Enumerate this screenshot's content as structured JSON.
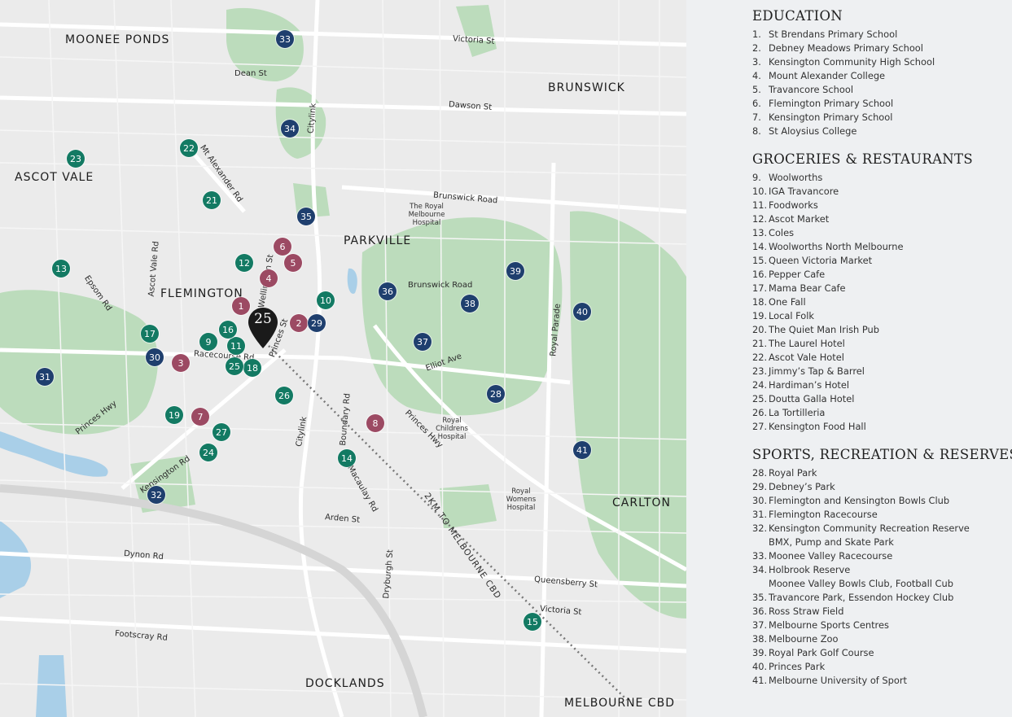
{
  "map": {
    "area_labels": [
      "MOONEE PONDS",
      "BRUNSWICK",
      "ASCOT VALE",
      "PARKVILLE",
      "FLEMINGTON",
      "CARLTON",
      "DOCKLANDS",
      "MELBOURNE CBD"
    ],
    "place_labels": [
      "The Royal Melbourne Hospital",
      "Royal Childrens Hospital",
      "Royal Womens Hospital"
    ],
    "streets": [
      "Victoria St",
      "Dean St",
      "Dawson St",
      "Citylink",
      "Mt Alexander Rd",
      "Brunswick Road",
      "Racecourse Rd",
      "Epsom Rd",
      "Ascot Vale Rd",
      "Wellington St",
      "Princes St",
      "Brunswick Road",
      "Elliot Ave",
      "Royal Parade",
      "Princes Hwy",
      "Princes Hwy",
      "Citylink",
      "Boundary Rd",
      "Macaulay Rd",
      "Kensington Rd",
      "Arden St",
      "Dynon Rd",
      "Dryburgh St",
      "Queensberry St",
      "Victoria St",
      "Footscray Rd"
    ],
    "route_label": "2KM TO MELBOURNE CBD",
    "property_marker": "25",
    "colors": {
      "education": "#9c4a63",
      "groceries": "#137a63",
      "sports": "#1f3f6e",
      "pin": "#1a1a1a",
      "park": "#b8dab8",
      "water": "#9ec7e6"
    },
    "markers": [
      {
        "n": "1",
        "cat": "education"
      },
      {
        "n": "2",
        "cat": "education"
      },
      {
        "n": "3",
        "cat": "education"
      },
      {
        "n": "4",
        "cat": "education"
      },
      {
        "n": "5",
        "cat": "education"
      },
      {
        "n": "6",
        "cat": "education"
      },
      {
        "n": "7",
        "cat": "education"
      },
      {
        "n": "8",
        "cat": "education"
      },
      {
        "n": "9",
        "cat": "groceries"
      },
      {
        "n": "10",
        "cat": "groceries"
      },
      {
        "n": "11",
        "cat": "groceries"
      },
      {
        "n": "12",
        "cat": "groceries"
      },
      {
        "n": "13",
        "cat": "groceries"
      },
      {
        "n": "14",
        "cat": "groceries"
      },
      {
        "n": "15",
        "cat": "groceries"
      },
      {
        "n": "16",
        "cat": "groceries"
      },
      {
        "n": "17",
        "cat": "groceries"
      },
      {
        "n": "18",
        "cat": "groceries"
      },
      {
        "n": "19",
        "cat": "groceries"
      },
      {
        "n": "21",
        "cat": "groceries"
      },
      {
        "n": "22",
        "cat": "groceries"
      },
      {
        "n": "23",
        "cat": "groceries"
      },
      {
        "n": "24",
        "cat": "groceries"
      },
      {
        "n": "25",
        "cat": "groceries"
      },
      {
        "n": "26",
        "cat": "groceries"
      },
      {
        "n": "27",
        "cat": "groceries"
      },
      {
        "n": "28",
        "cat": "sports"
      },
      {
        "n": "29",
        "cat": "sports"
      },
      {
        "n": "30",
        "cat": "sports"
      },
      {
        "n": "31",
        "cat": "sports"
      },
      {
        "n": "32",
        "cat": "sports"
      },
      {
        "n": "33",
        "cat": "sports"
      },
      {
        "n": "34",
        "cat": "sports"
      },
      {
        "n": "35",
        "cat": "sports"
      },
      {
        "n": "36",
        "cat": "sports"
      },
      {
        "n": "37",
        "cat": "sports"
      },
      {
        "n": "38",
        "cat": "sports"
      },
      {
        "n": "39",
        "cat": "sports"
      },
      {
        "n": "40",
        "cat": "sports"
      },
      {
        "n": "41",
        "cat": "sports"
      }
    ]
  },
  "legend": {
    "education": {
      "title": "EDUCATION",
      "items": [
        {
          "n": "1.",
          "name": "St Brendans Primary School"
        },
        {
          "n": "2.",
          "name": "Debney Meadows Primary School"
        },
        {
          "n": "3.",
          "name": "Kensington Community High School"
        },
        {
          "n": "4.",
          "name": "Mount Alexander College"
        },
        {
          "n": "5.",
          "name": "Travancore School"
        },
        {
          "n": "6.",
          "name": "Flemington Primary School"
        },
        {
          "n": "7.",
          "name": "Kensington Primary School"
        },
        {
          "n": "8.",
          "name": "St Aloysius College"
        }
      ]
    },
    "groceries": {
      "title": "GROCERIES & RESTAURANTS",
      "items": [
        {
          "n": "9.",
          "name": "Woolworths"
        },
        {
          "n": "10.",
          "name": "IGA Travancore"
        },
        {
          "n": "11.",
          "name": "Foodworks"
        },
        {
          "n": "12.",
          "name": "Ascot Market"
        },
        {
          "n": "13.",
          "name": "Coles"
        },
        {
          "n": "14.",
          "name": "Woolworths North Melbourne"
        },
        {
          "n": "15.",
          "name": "Queen Victoria Market"
        },
        {
          "n": "16.",
          "name": "Pepper Cafe"
        },
        {
          "n": "17.",
          "name": "Mama Bear Cafe"
        },
        {
          "n": "18.",
          "name": "One Fall"
        },
        {
          "n": "19.",
          "name": "Local Folk"
        },
        {
          "n": "20.",
          "name": "The Quiet Man Irish Pub"
        },
        {
          "n": "21.",
          "name": "The Laurel Hotel"
        },
        {
          "n": "22.",
          "name": "Ascot Vale Hotel"
        },
        {
          "n": "23.",
          "name": "Jimmy’s Tap & Barrel"
        },
        {
          "n": "24.",
          "name": "Hardiman’s Hotel"
        },
        {
          "n": "25.",
          "name": "Doutta Galla Hotel"
        },
        {
          "n": "26.",
          "name": "La Tortilleria"
        },
        {
          "n": "27.",
          "name": "Kensington Food Hall"
        }
      ]
    },
    "sports": {
      "title": "SPORTS, RECREATION & RESERVES",
      "items": [
        {
          "n": "28.",
          "name": "Royal Park"
        },
        {
          "n": "29.",
          "name": "Debney’s Park"
        },
        {
          "n": "30.",
          "name": "Flemington and Kensington Bowls Club"
        },
        {
          "n": "31.",
          "name": "Flemington Racecourse"
        },
        {
          "n": "32.",
          "name": "Kensington Community Recreation Reserve"
        },
        {
          "n": "",
          "name": "BMX, Pump and Skate Park"
        },
        {
          "n": "33.",
          "name": "Moonee Valley Racecourse"
        },
        {
          "n": "34.",
          "name": "Holbrook Reserve"
        },
        {
          "n": "",
          "name": "Moonee Valley Bowls Club, Football Cub"
        },
        {
          "n": "35.",
          "name": "Travancore Park, Essendon Hockey Club"
        },
        {
          "n": "36.",
          "name": "Ross Straw Field"
        },
        {
          "n": "37.",
          "name": "Melbourne Sports Centres"
        },
        {
          "n": "38.",
          "name": "Melbourne Zoo"
        },
        {
          "n": "39.",
          "name": "Royal Park Golf Course"
        },
        {
          "n": "40.",
          "name": "Princes Park"
        },
        {
          "n": "41.",
          "name": "Melbourne University of Sport"
        }
      ]
    }
  }
}
